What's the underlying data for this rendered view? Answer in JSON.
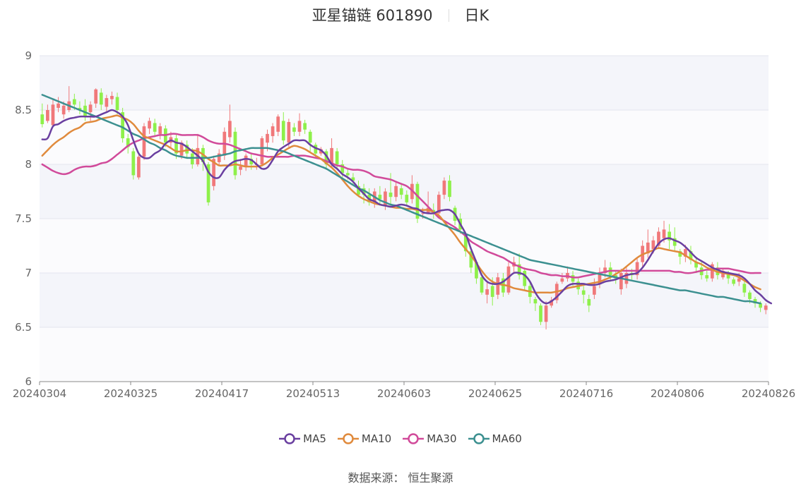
{
  "header": {
    "title": "亚星锚链 601890",
    "period": "日K"
  },
  "source_text": "数据来源： 恒生聚源",
  "colors": {
    "up": "#f0787a",
    "down": "#8ef04a",
    "MA5": "#6a3fa0",
    "MA10": "#e08a3c",
    "MA30": "#d14a9a",
    "MA60": "#3c9090"
  },
  "chart_data": {
    "type": "candlestick",
    "ylim": [
      6,
      9
    ],
    "y_ticks": [
      "6",
      "6.5",
      "7",
      "7.5",
      "8",
      "8.5",
      "9"
    ],
    "x_ticks": [
      "20240304",
      "20240325",
      "20240417",
      "20240513",
      "20240603",
      "20240625",
      "20240716",
      "20240806",
      "20240826"
    ],
    "grid": true,
    "legend_position": "bottom",
    "candles": [
      [
        8.46,
        8.37,
        8.56,
        8.34
      ],
      [
        8.4,
        8.5,
        8.55,
        8.38
      ],
      [
        8.36,
        8.55,
        8.6,
        8.34
      ],
      [
        8.52,
        8.56,
        8.62,
        8.48
      ],
      [
        8.46,
        8.54,
        8.58,
        8.42
      ],
      [
        8.5,
        8.58,
        8.72,
        8.48
      ],
      [
        8.6,
        8.55,
        8.65,
        8.5
      ],
      [
        8.52,
        8.5,
        8.58,
        8.46
      ],
      [
        8.54,
        8.44,
        8.6,
        8.4
      ],
      [
        8.48,
        8.55,
        8.58,
        8.4
      ],
      [
        8.56,
        8.69,
        8.7,
        8.52
      ],
      [
        8.66,
        8.55,
        8.7,
        8.5
      ],
      [
        8.53,
        8.61,
        8.64,
        8.48
      ],
      [
        8.6,
        8.63,
        8.67,
        8.55
      ],
      [
        8.62,
        8.5,
        8.66,
        8.46
      ],
      [
        8.48,
        8.24,
        8.52,
        8.2
      ],
      [
        8.24,
        8.16,
        8.28,
        8.1
      ],
      [
        8.12,
        7.9,
        8.15,
        7.86
      ],
      [
        7.88,
        8.07,
        8.1,
        7.86
      ],
      [
        8.07,
        8.35,
        8.38,
        8.04
      ],
      [
        8.33,
        8.4,
        8.43,
        8.28
      ],
      [
        8.38,
        8.3,
        8.42,
        8.25
      ],
      [
        8.28,
        8.35,
        8.38,
        8.23
      ],
      [
        8.33,
        8.2,
        8.36,
        8.16
      ],
      [
        8.2,
        8.25,
        8.3,
        8.15
      ],
      [
        8.24,
        8.1,
        8.28,
        8.05
      ],
      [
        8.08,
        8.2,
        8.22,
        8.05
      ],
      [
        8.18,
        8.1,
        8.22,
        8.05
      ],
      [
        8.1,
        8.0,
        8.15,
        7.96
      ],
      [
        8.0,
        8.15,
        8.28,
        7.98
      ],
      [
        8.15,
        8.02,
        8.18,
        7.94
      ],
      [
        8.0,
        7.65,
        8.02,
        7.62
      ],
      [
        7.8,
        8.05,
        8.08,
        7.76
      ],
      [
        8.02,
        8.1,
        8.14,
        8.0
      ],
      [
        8.08,
        8.3,
        8.34,
        8.04
      ],
      [
        8.25,
        8.4,
        8.55,
        8.2
      ],
      [
        8.3,
        7.9,
        8.34,
        7.86
      ],
      [
        7.95,
        7.98,
        8.05,
        7.9
      ],
      [
        7.98,
        8.08,
        8.1,
        7.94
      ],
      [
        8.05,
        8.0,
        8.1,
        7.95
      ],
      [
        8.0,
        8.0,
        8.06,
        7.95
      ],
      [
        8.0,
        8.24,
        8.26,
        7.98
      ],
      [
        8.2,
        8.28,
        8.32,
        8.12
      ],
      [
        8.26,
        8.35,
        8.38,
        8.2
      ],
      [
        8.3,
        8.44,
        8.46,
        8.26
      ],
      [
        8.4,
        8.22,
        8.48,
        8.18
      ],
      [
        8.2,
        8.39,
        8.42,
        8.16
      ],
      [
        8.34,
        8.3,
        8.38,
        8.26
      ],
      [
        8.3,
        8.4,
        8.47,
        8.26
      ],
      [
        8.38,
        8.32,
        8.41,
        8.28
      ],
      [
        8.3,
        8.2,
        8.32,
        8.12
      ],
      [
        8.18,
        8.1,
        8.2,
        8.06
      ],
      [
        8.1,
        8.14,
        8.16,
        8.08
      ],
      [
        8.12,
        8.0,
        8.14,
        7.96
      ],
      [
        8.0,
        8.15,
        8.24,
        7.98
      ],
      [
        8.12,
        8.0,
        8.15,
        7.96
      ],
      [
        8.0,
        7.92,
        8.04,
        7.88
      ],
      [
        7.92,
        7.9,
        7.96,
        7.86
      ],
      [
        7.88,
        7.85,
        7.92,
        7.82
      ],
      [
        7.8,
        7.72,
        7.85,
        7.7
      ],
      [
        7.78,
        7.72,
        7.82,
        7.64
      ],
      [
        7.72,
        7.65,
        7.78,
        7.62
      ],
      [
        7.65,
        7.75,
        7.78,
        7.6
      ],
      [
        7.72,
        7.68,
        7.8,
        7.62
      ],
      [
        7.62,
        7.75,
        7.78,
        7.58
      ],
      [
        7.74,
        7.7,
        7.92,
        7.62
      ],
      [
        7.7,
        7.8,
        7.84,
        7.66
      ],
      [
        7.78,
        7.72,
        7.82,
        7.68
      ],
      [
        7.72,
        7.65,
        7.76,
        7.62
      ],
      [
        7.68,
        7.82,
        7.9,
        7.64
      ],
      [
        7.82,
        7.5,
        7.84,
        7.46
      ],
      [
        7.55,
        7.55,
        7.6,
        7.5
      ],
      [
        7.55,
        7.6,
        7.75,
        7.54
      ],
      [
        7.58,
        7.55,
        7.64,
        7.5
      ],
      [
        7.55,
        7.72,
        7.75,
        7.54
      ],
      [
        7.72,
        7.85,
        7.88,
        7.68
      ],
      [
        7.85,
        7.7,
        7.9,
        7.66
      ],
      [
        7.6,
        7.48,
        7.62,
        7.44
      ],
      [
        7.5,
        7.4,
        7.55,
        7.36
      ],
      [
        7.35,
        7.2,
        7.38,
        7.15
      ],
      [
        7.2,
        7.05,
        7.24,
        7.0
      ],
      [
        7.1,
        6.95,
        7.12,
        6.9
      ],
      [
        6.96,
        6.82,
        7.0,
        6.8
      ],
      [
        6.8,
        6.85,
        6.92,
        6.72
      ],
      [
        6.88,
        6.78,
        6.96,
        6.7
      ],
      [
        6.8,
        6.96,
        7.0,
        6.76
      ],
      [
        6.95,
        6.82,
        7.0,
        6.78
      ],
      [
        6.82,
        7.06,
        7.1,
        6.8
      ],
      [
        7.06,
        7.1,
        7.15,
        7.0
      ],
      [
        7.08,
        6.98,
        7.18,
        6.94
      ],
      [
        7.02,
        6.88,
        7.05,
        6.84
      ],
      [
        6.88,
        6.78,
        6.92,
        6.72
      ],
      [
        6.76,
        6.72,
        6.78,
        6.65
      ],
      [
        6.7,
        6.55,
        6.72,
        6.52
      ],
      [
        6.55,
        6.7,
        6.74,
        6.48
      ],
      [
        6.7,
        6.75,
        6.78,
        6.68
      ],
      [
        6.75,
        6.9,
        6.92,
        6.72
      ],
      [
        6.92,
        6.95,
        7.0,
        6.9
      ],
      [
        6.95,
        7.0,
        7.06,
        6.92
      ],
      [
        6.98,
        6.92,
        7.02,
        6.88
      ],
      [
        6.92,
        6.85,
        6.95,
        6.8
      ],
      [
        6.84,
        6.8,
        6.88,
        6.72
      ],
      [
        6.76,
        6.7,
        6.8,
        6.64
      ],
      [
        6.8,
        6.88,
        6.95,
        6.76
      ],
      [
        6.9,
        7.0,
        7.05,
        6.86
      ],
      [
        7.0,
        7.05,
        7.12,
        6.96
      ],
      [
        7.05,
        6.98,
        7.1,
        6.92
      ],
      [
        6.98,
        6.95,
        7.02,
        6.9
      ],
      [
        6.85,
        7.0,
        7.04,
        6.8
      ],
      [
        6.9,
        7.0,
        7.05,
        6.86
      ],
      [
        7.0,
        6.98,
        7.04,
        6.94
      ],
      [
        6.98,
        7.1,
        7.14,
        6.94
      ],
      [
        7.1,
        7.25,
        7.3,
        7.06
      ],
      [
        7.18,
        7.28,
        7.4,
        7.14
      ],
      [
        7.22,
        7.3,
        7.34,
        7.18
      ],
      [
        7.25,
        7.38,
        7.42,
        7.22
      ],
      [
        7.32,
        7.4,
        7.48,
        7.28
      ],
      [
        7.38,
        7.3,
        7.45,
        7.22
      ],
      [
        7.32,
        7.25,
        7.42,
        7.2
      ],
      [
        7.2,
        7.15,
        7.22,
        7.08
      ],
      [
        7.15,
        7.22,
        7.26,
        7.1
      ],
      [
        7.2,
        7.12,
        7.25,
        7.08
      ],
      [
        7.1,
        7.05,
        7.14,
        7.0
      ],
      [
        7.05,
        6.98,
        7.1,
        6.94
      ],
      [
        6.98,
        6.95,
        7.02,
        6.92
      ],
      [
        6.95,
        7.08,
        7.1,
        6.92
      ],
      [
        7.05,
        6.98,
        7.1,
        6.94
      ],
      [
        6.96,
        7.02,
        7.04,
        6.94
      ],
      [
        7.0,
        6.95,
        7.02,
        6.9
      ],
      [
        6.94,
        6.9,
        6.96,
        6.88
      ],
      [
        6.92,
        6.95,
        7.0,
        6.88
      ],
      [
        6.9,
        6.82,
        6.92,
        6.78
      ],
      [
        6.82,
        6.76,
        6.84,
        6.72
      ],
      [
        6.76,
        6.72,
        6.78,
        6.68
      ],
      [
        6.72,
        6.68,
        6.74,
        6.64
      ],
      [
        6.66,
        6.7,
        6.72,
        6.62
      ]
    ],
    "series": [
      {
        "name": "MA5",
        "key": "MA5",
        "values": [
          8.23,
          8.24,
          8.35,
          8.37,
          8.4,
          8.42,
          8.43,
          8.44,
          8.44,
          8.44,
          8.44,
          8.46,
          8.48,
          8.5,
          8.48,
          8.44,
          8.36,
          8.22,
          8.1,
          8.06,
          8.06,
          8.1,
          8.13,
          8.19,
          8.22,
          8.2,
          8.19,
          8.16,
          8.12,
          8.08,
          8.03,
          7.93,
          7.88,
          7.88,
          7.95,
          8.0,
          8.03,
          8.04,
          8.05,
          8.04,
          8.0,
          7.96,
          7.97,
          8.04,
          8.12,
          8.16,
          8.19,
          8.22,
          8.22,
          8.22,
          8.18,
          8.15,
          8.13,
          8.08,
          8.0,
          7.96,
          7.91,
          7.88,
          7.84,
          7.78,
          7.73,
          7.68,
          7.66,
          7.63,
          7.62,
          7.61,
          7.62,
          7.63,
          7.62,
          7.6,
          7.59,
          7.56,
          7.55,
          7.55,
          7.57,
          7.58,
          7.58,
          7.54,
          7.45,
          7.36,
          7.22,
          7.1,
          6.98,
          6.92,
          6.9,
          6.9,
          6.92,
          6.96,
          7.0,
          7.0,
          6.98,
          6.92,
          6.82,
          6.75,
          6.72,
          6.74,
          6.78,
          6.83,
          6.88,
          6.9,
          6.9,
          6.9,
          6.89,
          6.89,
          6.9,
          6.92,
          6.93,
          6.94,
          6.96,
          6.98,
          6.99,
          7.0,
          7.05,
          7.12,
          7.2,
          7.27,
          7.31,
          7.32,
          7.3,
          7.28,
          7.24,
          7.19,
          7.14,
          7.11,
          7.08,
          7.05,
          7.03,
          7.01,
          7.0,
          6.99,
          6.98,
          6.95,
          6.9,
          6.84,
          6.8,
          6.75,
          6.72
        ]
      },
      {
        "name": "MA10",
        "key": "MA10",
        "values": [
          8.08,
          8.13,
          8.18,
          8.22,
          8.25,
          8.29,
          8.32,
          8.34,
          8.38,
          8.39,
          8.4,
          8.42,
          8.43,
          8.44,
          8.45,
          8.43,
          8.41,
          8.37,
          8.31,
          8.26,
          8.24,
          8.22,
          8.2,
          8.18,
          8.15,
          8.12,
          8.12,
          8.13,
          8.13,
          8.12,
          8.09,
          8.05,
          8.02,
          7.99,
          7.99,
          7.99,
          8.0,
          7.99,
          7.98,
          7.98,
          7.98,
          7.99,
          8.02,
          8.06,
          8.09,
          8.12,
          8.15,
          8.17,
          8.16,
          8.14,
          8.11,
          8.08,
          8.05,
          8.01,
          7.97,
          7.92,
          7.86,
          7.8,
          7.75,
          7.71,
          7.68,
          7.66,
          7.64,
          7.63,
          7.62,
          7.61,
          7.6,
          7.6,
          7.59,
          7.59,
          7.58,
          7.58,
          7.58,
          7.56,
          7.53,
          7.47,
          7.41,
          7.35,
          7.28,
          7.22,
          7.16,
          7.09,
          7.02,
          6.96,
          6.92,
          6.9,
          6.89,
          6.88,
          6.86,
          6.85,
          6.84,
          6.83,
          6.82,
          6.82,
          6.82,
          6.82,
          6.83,
          6.84,
          6.86,
          6.87,
          6.88,
          6.89,
          6.9,
          6.91,
          6.92,
          6.94,
          6.96,
          6.99,
          7.02,
          7.06,
          7.1,
          7.14,
          7.17,
          7.19,
          7.21,
          7.23,
          7.22,
          7.21,
          7.2,
          7.19,
          7.16,
          7.13,
          7.1,
          7.08,
          7.05,
          7.03,
          7.01,
          7.0,
          6.99,
          6.98,
          6.96,
          6.93,
          6.9,
          6.87,
          6.85
        ]
      },
      {
        "name": "MA30",
        "key": "MA30",
        "values": [
          8.0,
          7.97,
          7.94,
          7.92,
          7.91,
          7.92,
          7.95,
          7.97,
          7.98,
          7.98,
          7.99,
          8.01,
          8.02,
          8.05,
          8.09,
          8.13,
          8.17,
          8.2,
          8.22,
          8.24,
          8.25,
          8.26,
          8.27,
          8.27,
          8.28,
          8.28,
          8.27,
          8.27,
          8.27,
          8.27,
          8.25,
          8.22,
          8.2,
          8.19,
          8.19,
          8.18,
          8.16,
          8.14,
          8.12,
          8.1,
          8.09,
          8.08,
          8.07,
          8.07,
          8.07,
          8.07,
          8.07,
          8.08,
          8.08,
          8.08,
          8.07,
          8.06,
          8.05,
          8.03,
          8.01,
          7.99,
          7.98,
          7.96,
          7.95,
          7.95,
          7.94,
          7.92,
          7.89,
          7.88,
          7.87,
          7.86,
          7.84,
          7.82,
          7.8,
          7.76,
          7.71,
          7.66,
          7.61,
          7.56,
          7.51,
          7.48,
          7.45,
          7.42,
          7.38,
          7.34,
          7.29,
          7.26,
          7.23,
          7.2,
          7.18,
          7.16,
          7.14,
          7.11,
          7.08,
          7.06,
          7.04,
          7.03,
          7.02,
          7.0,
          6.99,
          6.98,
          6.98,
          6.97,
          6.97,
          6.96,
          6.96,
          6.97,
          6.98,
          6.99,
          7.0,
          7.01,
          7.02,
          7.02,
          7.02,
          7.02,
          7.02,
          7.02,
          7.02,
          7.02,
          7.02,
          7.02,
          7.02,
          7.02,
          7.01,
          7.01,
          7.0,
          7.0,
          7.01,
          7.02,
          7.03,
          7.03,
          7.04,
          7.04,
          7.04,
          7.03,
          7.02,
          7.01,
          7.0,
          7.0,
          7.0
        ]
      },
      {
        "name": "MA60",
        "key": "MA60",
        "values": [
          8.64,
          8.62,
          8.6,
          8.58,
          8.56,
          8.54,
          8.52,
          8.5,
          8.48,
          8.46,
          8.44,
          8.42,
          8.4,
          8.38,
          8.36,
          8.34,
          8.31,
          8.28,
          8.26,
          8.23,
          8.2,
          8.18,
          8.15,
          8.13,
          8.1,
          8.08,
          8.07,
          8.06,
          8.06,
          8.06,
          8.06,
          8.06,
          8.07,
          8.08,
          8.09,
          8.1,
          8.12,
          8.13,
          8.14,
          8.15,
          8.15,
          8.15,
          8.15,
          8.14,
          8.13,
          8.12,
          8.1,
          8.08,
          8.06,
          8.04,
          8.02,
          8.0,
          7.98,
          7.96,
          7.93,
          7.9,
          7.87,
          7.84,
          7.81,
          7.78,
          7.76,
          7.73,
          7.7,
          7.67,
          7.65,
          7.63,
          7.62,
          7.6,
          7.58,
          7.56,
          7.54,
          7.52,
          7.5,
          7.48,
          7.46,
          7.44,
          7.42,
          7.4,
          7.38,
          7.36,
          7.34,
          7.32,
          7.3,
          7.28,
          7.26,
          7.24,
          7.22,
          7.2,
          7.18,
          7.16,
          7.14,
          7.12,
          7.11,
          7.1,
          7.09,
          7.08,
          7.07,
          7.06,
          7.05,
          7.04,
          7.03,
          7.02,
          7.01,
          7.0,
          6.99,
          6.98,
          6.97,
          6.96,
          6.95,
          6.94,
          6.93,
          6.92,
          6.91,
          6.9,
          6.89,
          6.88,
          6.87,
          6.86,
          6.85,
          6.84,
          6.84,
          6.83,
          6.82,
          6.81,
          6.8,
          6.79,
          6.78,
          6.78,
          6.77,
          6.76,
          6.75,
          6.74,
          6.74,
          6.73,
          6.72
        ]
      }
    ]
  }
}
